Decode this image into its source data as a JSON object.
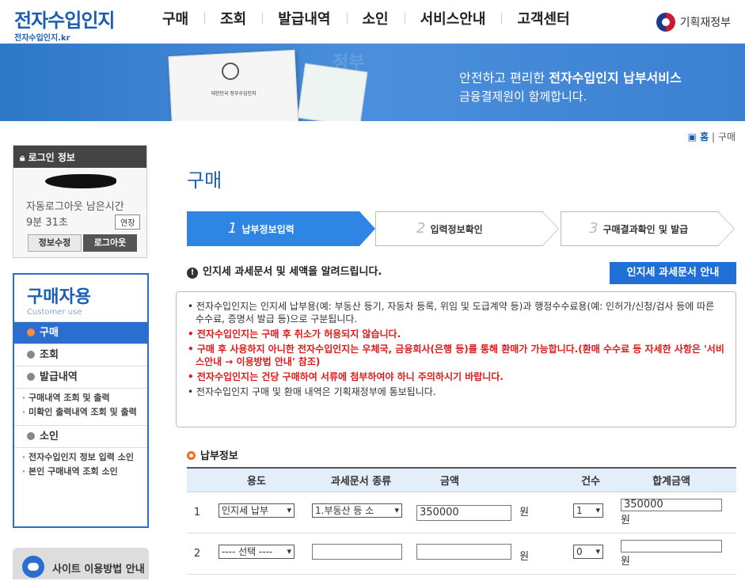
{
  "header": {
    "logo_main": "전자수입인지",
    "logo_sub": "전자수입인지.kr",
    "nav": [
      "구매",
      "조회",
      "발급내역",
      "소인",
      "서비스안내",
      "고객센터"
    ],
    "gov_label": "기획재정부"
  },
  "banner": {
    "line1_pre": "안전하고 편리한 ",
    "line1_bold": "전자수입인지 납부서비스",
    "line2": "금융결제원이 함께합니다.",
    "doc_title": "대한민국 정부수입인지",
    "stamp": "정부"
  },
  "breadcrumb": {
    "home": "홈",
    "sep": "|",
    "current": "구매"
  },
  "login": {
    "title": "로그인 정보",
    "remain_label": "자동로그아웃 남은시간",
    "remain_time": "9분 31초",
    "extend": "연장",
    "info_btn": "정보수정",
    "logout_btn": "로그아웃"
  },
  "lnb": {
    "title": "구매자용",
    "subtitle": "Customer use",
    "items": [
      "구매",
      "조회",
      "발급내역",
      "소인"
    ],
    "sub_history": [
      "구매내역 조회 및 출력",
      "미확인 출력내역 조회 및 출력"
    ],
    "sub_cancel": [
      "전자수입인지 정보 입력 소인",
      "본인 구매내역 조회 소인"
    ]
  },
  "guide": {
    "label": "사이트 이용방법 안내"
  },
  "page": {
    "title": "구매"
  },
  "steps": [
    {
      "num": "1",
      "label": "납부정보입력"
    },
    {
      "num": "2",
      "label": "입력정보확인"
    },
    {
      "num": "3",
      "label": "구매결과확인 및 발급"
    }
  ],
  "notice": {
    "heading": "인지세 과세문서 및 세액을 알려드립니다.",
    "button": "인지세 과세문서 안내",
    "items": [
      "전자수입인지는 인지세 납부용(예: 부동산 등기, 자동차 등록, 위임 및 도급계약 등)과 행정수수료용(예: 인허가/신청/검사 등에 따른 수수료, 증명서 발급 등)으로 구분됩니다.",
      "전자수입인지는 구매 후 취소가 허용되지 않습니다.",
      "구매 후 사용하지 아니한 전자수입인지는 우체국, 금융회사(은행 등)를 통해 환매가 가능합니다.(환매 수수료 등 자세한 사항은 '서비스안내 → 이용방법 안내' 참조)",
      "전자수입인지는 건당 구매하여 서류에 첨부하여야 하니 주의하시기 바랍니다.",
      "전자수입인지 구매 및 환매 내역은 기획재정부에 통보됩니다."
    ]
  },
  "payment": {
    "title": "납부정보",
    "headers": [
      "용도",
      "과세문서 종류",
      "금액",
      "건수",
      "합계금액"
    ],
    "won": "원",
    "rows": [
      {
        "no": "1",
        "usage": "인지세 납부",
        "doc": "1.부동산 등 소",
        "amount": "350000",
        "count": "1",
        "total": "350000"
      },
      {
        "no": "2",
        "usage": "---- 선택 ----",
        "doc": "",
        "amount": "",
        "count": "0",
        "total": ""
      }
    ]
  }
}
